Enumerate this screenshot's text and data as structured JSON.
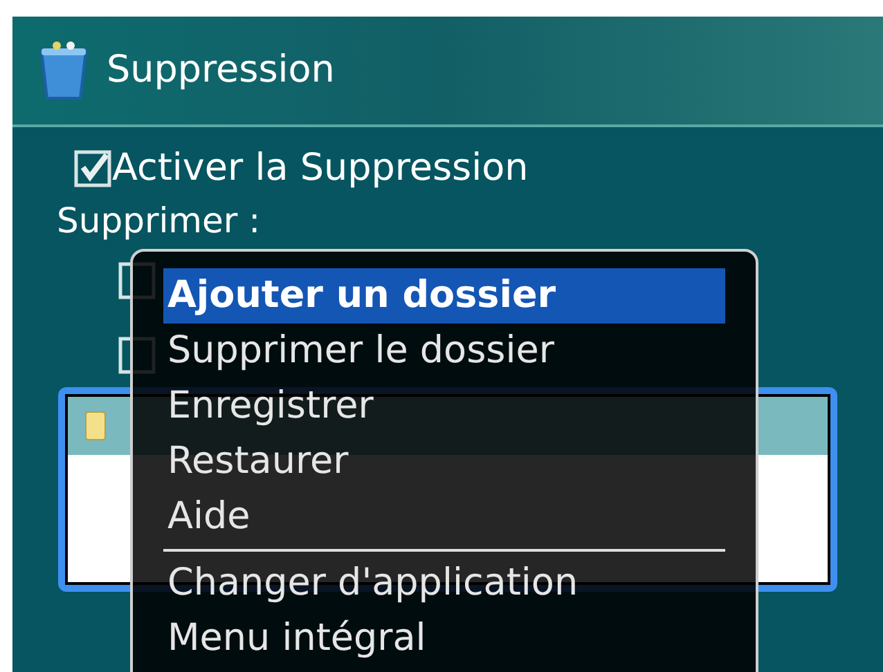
{
  "window": {
    "title": "Suppression"
  },
  "enable": {
    "label": "Activer la Suppression",
    "checked": true
  },
  "section_label": "Supprimer :",
  "options": [
    {
      "checked": false
    },
    {
      "checked": false
    }
  ],
  "folders": [
    {
      "selected": true
    }
  ],
  "menu": {
    "items": [
      {
        "label": "Ajouter un dossier",
        "selected": true,
        "kind": "item"
      },
      {
        "label": "Supprimer le dossier",
        "selected": false,
        "kind": "item"
      },
      {
        "label": "Enregistrer",
        "selected": false,
        "kind": "item"
      },
      {
        "label": "Restaurer",
        "selected": false,
        "kind": "item"
      },
      {
        "label": "Aide",
        "selected": false,
        "kind": "item"
      },
      {
        "kind": "separator"
      },
      {
        "label": "Changer d'application",
        "selected": false,
        "kind": "item"
      },
      {
        "label": "Menu intégral",
        "selected": false,
        "kind": "item"
      }
    ]
  }
}
